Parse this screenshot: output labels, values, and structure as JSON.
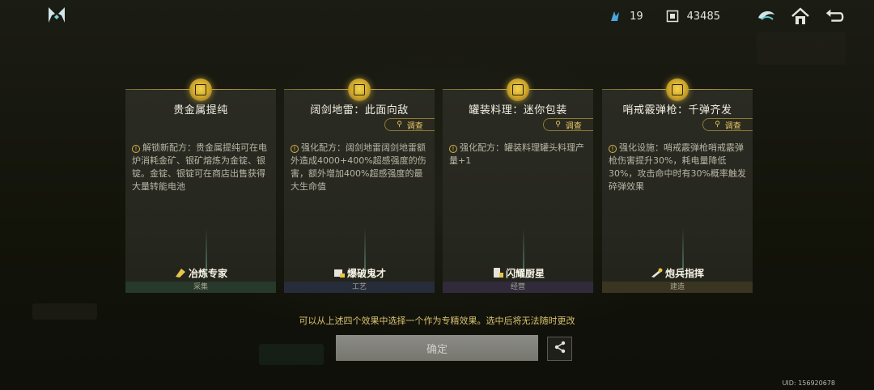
{
  "topbar": {
    "shards_count": "19",
    "currency_count": "43485",
    "icons": [
      "logo-icon",
      "shard-icon",
      "currency-icon",
      "emblem-icon",
      "home-icon",
      "back-icon"
    ]
  },
  "investigate_label": "调查",
  "cards": [
    {
      "title": "贵金属提纯",
      "desc": "解锁新配方：贵金属提纯可在电炉消耗金矿、银矿熔炼为金锭、银锭。金锭、银锭可在商店出售获得大量转能电池",
      "role": "冶炼专家",
      "category": "采集",
      "category_color": "#27392a",
      "has_investigate": false
    },
    {
      "title": "阔剑地雷：此面向敌",
      "desc": "强化配方：阔剑地雷阔剑地雷额外造成4000+400%超感强度的伤害，额外增加400%超感强度的最大生命值",
      "role": "爆破鬼才",
      "category": "工艺",
      "category_color": "#272c3a",
      "has_investigate": true
    },
    {
      "title": "罐装料理：迷你包装",
      "desc": "强化配方：罐装料理罐头料理产量+1",
      "role": "闪耀厨星",
      "category": "经营",
      "category_color": "#302a3a",
      "has_investigate": true
    },
    {
      "title": "哨戒霰弹枪：千弹齐发",
      "desc": "强化设施：哨戒霰弹枪哨戒霰弹枪伤害提升30%，耗电量降低30%，攻击命中时有30%概率触发碎弹效果",
      "role": "炮兵指挥",
      "category": "建造",
      "category_color": "#3a3520",
      "has_investigate": true
    }
  ],
  "hint": "可以从上述四个效果中选择一个作为专精效果。选中后将无法随时更改",
  "confirm_label": "确定",
  "uid": "UID: 156920678"
}
